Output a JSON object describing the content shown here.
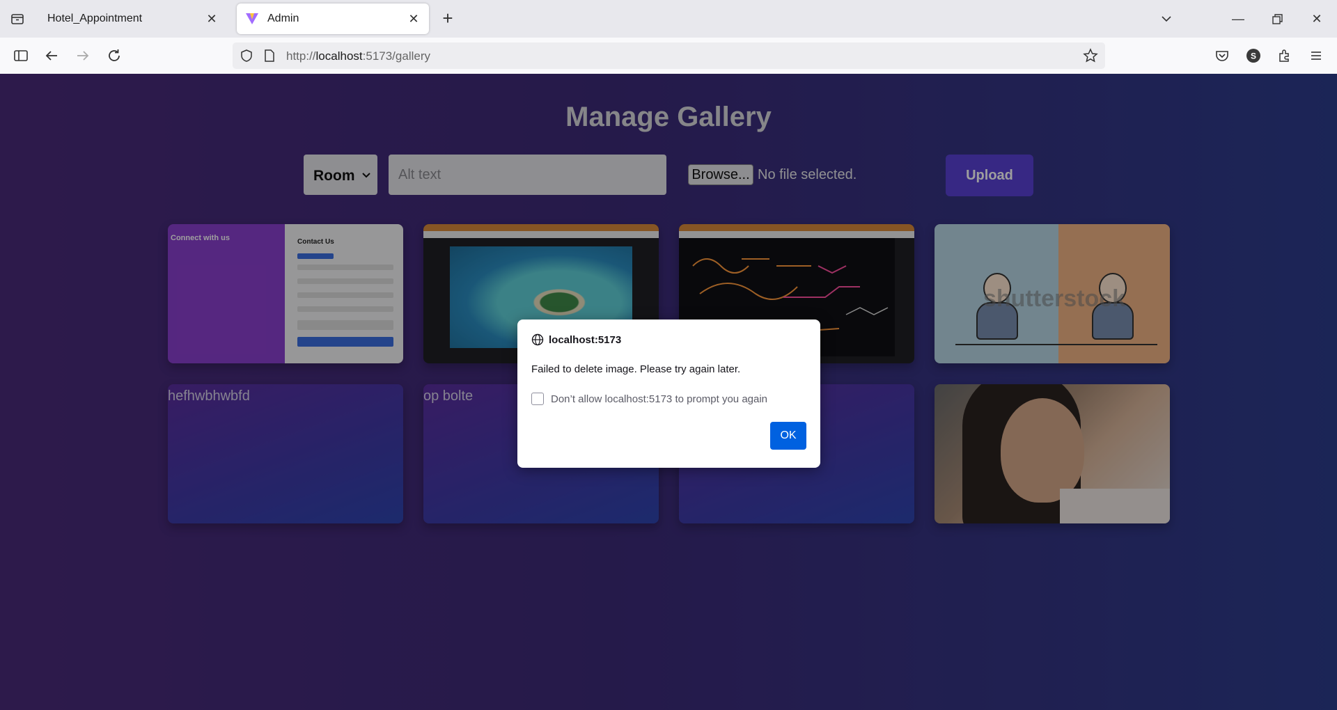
{
  "browser": {
    "tabs": [
      {
        "label": "Hotel_Appointment",
        "active": false
      },
      {
        "label": "Admin",
        "active": true
      }
    ],
    "url_prefix": "http://",
    "url_host": "localhost",
    "url_rest": ":5173/gallery"
  },
  "page": {
    "title": "Manage Gallery",
    "category_select": {
      "value": "Room"
    },
    "alt_input": {
      "placeholder": "Alt text",
      "value": ""
    },
    "browse_label": "Browse...",
    "file_status": "No file selected.",
    "upload_label": "Upload"
  },
  "gallery": {
    "cards": [
      {
        "type": "image",
        "icon": "contact-form-screenshot",
        "texts": {
          "heading": "Connect with us",
          "form_title": "Contact Us"
        }
      },
      {
        "type": "image",
        "icon": "island-screenshot"
      },
      {
        "type": "image",
        "icon": "chemistry-board-screenshot"
      },
      {
        "type": "image",
        "icon": "shutterstock-illustration",
        "watermark": "shutterstock"
      },
      {
        "type": "broken",
        "alt": "hefhwbhwbfd"
      },
      {
        "type": "broken",
        "alt": "op bolte"
      },
      {
        "type": "broken",
        "alt": ""
      },
      {
        "type": "image",
        "icon": "portrait-photo"
      }
    ]
  },
  "dialog": {
    "origin": "localhost:5173",
    "message": "Failed to delete image. Please try again later.",
    "checkbox_label": "Don’t allow localhost:5173 to prompt you again",
    "checkbox_checked": false,
    "ok_label": "OK"
  },
  "colors": {
    "page_gradient_start": "#4a2a7a",
    "page_gradient_end": "#2d3c8c",
    "upload_button": "#5a42d6",
    "dialog_ok": "#0061e0"
  }
}
